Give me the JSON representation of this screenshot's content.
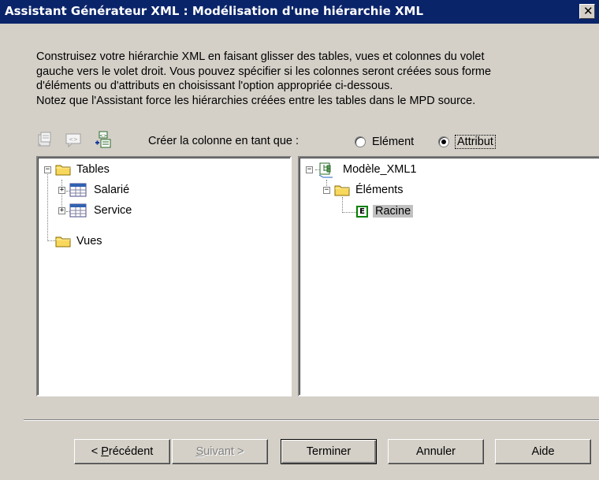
{
  "window": {
    "title": "Assistant Générateur XML : Modélisation d'une hiérarchie XML",
    "close_glyph": "✕"
  },
  "description": {
    "lines": [
      "Construisez votre hiérarchie XML en faisant glisser des tables, vues et colonnes du volet",
      "gauche vers le volet droit. Vous pouvez spécifier si les colonnes seront créées sous forme",
      "d'éléments ou d'attributs en choisissant l'option appropriée ci-dessous.",
      "Notez que l'Assistant force les hiérarchies créées entre les tables dans le MPD source."
    ]
  },
  "toolbar": {
    "icons": [
      "properties-icon",
      "xml-element-icon",
      "add-element-icon"
    ]
  },
  "create_as": {
    "label": "Créer la colonne en tant que :",
    "options": [
      {
        "label": "Elément",
        "selected": false
      },
      {
        "label": "Attribut",
        "selected": true
      }
    ]
  },
  "left_tree": {
    "nodes": [
      {
        "label": "Tables",
        "type": "folder",
        "expanded": true
      },
      {
        "label": "Salarié",
        "type": "table",
        "expanded": false
      },
      {
        "label": "Service",
        "type": "table",
        "expanded": false
      },
      {
        "label": "Vues",
        "type": "folder"
      }
    ]
  },
  "right_tree": {
    "nodes": [
      {
        "label": "Modèle_XML1",
        "type": "model",
        "expanded": true
      },
      {
        "label": "Éléments",
        "type": "folder",
        "expanded": true
      },
      {
        "label": "Racine",
        "type": "element",
        "badge": "E",
        "selected": true
      }
    ]
  },
  "buttons": {
    "previous": {
      "prefix": "< ",
      "accel": "P",
      "rest": "récédent"
    },
    "next": {
      "accel": "S",
      "rest": "uivant >"
    },
    "finish": "Terminer",
    "cancel": "Annuler",
    "help": "Aide"
  },
  "colors": {
    "title_bar": "#0a246a",
    "face": "#d4d0c8",
    "selection": "#c0c0c0",
    "folder": "#f8d85c",
    "element_badge": "#008000"
  }
}
